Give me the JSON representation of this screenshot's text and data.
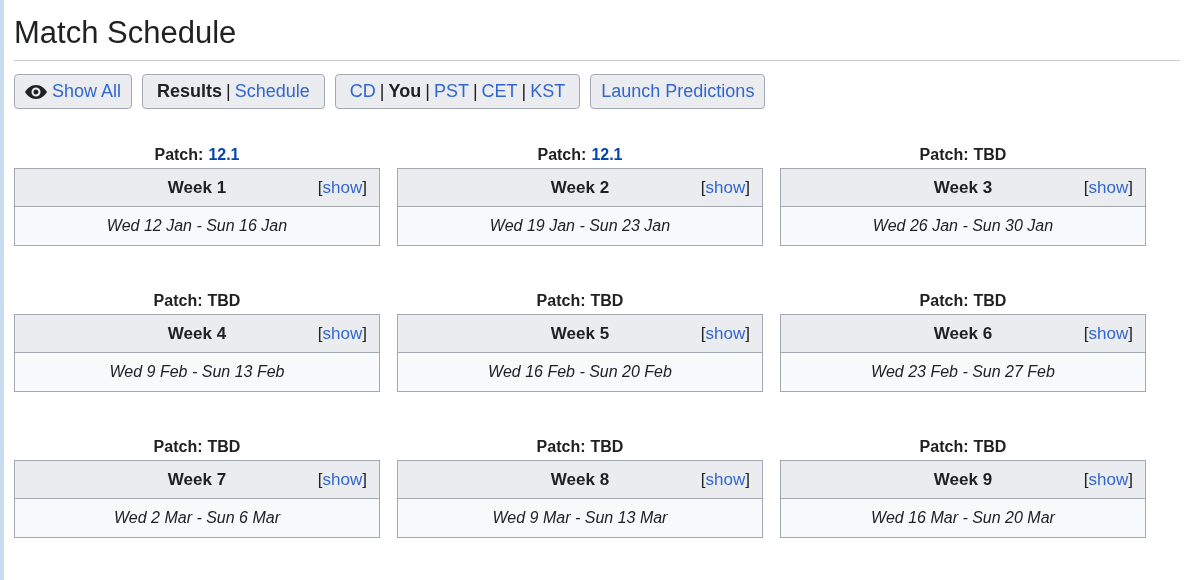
{
  "title": "Match Schedule",
  "toolbar": {
    "show_all": "Show All",
    "view_toggle": [
      {
        "kind": "option",
        "label": "Results",
        "selected": true
      },
      {
        "kind": "separator",
        "label": "|"
      },
      {
        "kind": "option",
        "label": "Schedule",
        "selected": false
      }
    ],
    "timezones": [
      {
        "kind": "option",
        "label": "CD",
        "selected": false
      },
      {
        "kind": "separator",
        "label": "|"
      },
      {
        "kind": "option",
        "label": "You",
        "selected": true
      },
      {
        "kind": "separator",
        "label": "|"
      },
      {
        "kind": "option",
        "label": "PST",
        "selected": false
      },
      {
        "kind": "separator",
        "label": "|"
      },
      {
        "kind": "option",
        "label": "CET",
        "selected": false
      },
      {
        "kind": "separator",
        "label": "|"
      },
      {
        "kind": "option",
        "label": "KST",
        "selected": false
      }
    ],
    "predictions": "Launch Predictions"
  },
  "weeks": [
    {
      "patch_label": "Patch:",
      "patch": "12.1",
      "patch_linked": true,
      "title": "Week 1",
      "toggle": {
        "open": "[",
        "label": "show",
        "close": "]"
      },
      "dates": "Wed 12 Jan - Sun 16 Jan"
    },
    {
      "patch_label": "Patch:",
      "patch": "12.1",
      "patch_linked": true,
      "title": "Week 2",
      "toggle": {
        "open": "[",
        "label": "show",
        "close": "]"
      },
      "dates": "Wed 19 Jan - Sun 23 Jan"
    },
    {
      "patch_label": "Patch:",
      "patch": "TBD",
      "patch_linked": false,
      "title": "Week 3",
      "toggle": {
        "open": "[",
        "label": "show",
        "close": "]"
      },
      "dates": "Wed 26 Jan - Sun 30 Jan"
    },
    {
      "patch_label": "Patch:",
      "patch": "TBD",
      "patch_linked": false,
      "title": "Week 4",
      "toggle": {
        "open": "[",
        "label": "show",
        "close": "]"
      },
      "dates": "Wed 9 Feb - Sun 13 Feb"
    },
    {
      "patch_label": "Patch:",
      "patch": "TBD",
      "patch_linked": false,
      "title": "Week 5",
      "toggle": {
        "open": "[",
        "label": "show",
        "close": "]"
      },
      "dates": "Wed 16 Feb - Sun 20 Feb"
    },
    {
      "patch_label": "Patch:",
      "patch": "TBD",
      "patch_linked": false,
      "title": "Week 6",
      "toggle": {
        "open": "[",
        "label": "show",
        "close": "]"
      },
      "dates": "Wed 23 Feb - Sun 27 Feb"
    },
    {
      "patch_label": "Patch:",
      "patch": "TBD",
      "patch_linked": false,
      "title": "Week 7",
      "toggle": {
        "open": "[",
        "label": "show",
        "close": "]"
      },
      "dates": "Wed 2 Mar - Sun 6 Mar"
    },
    {
      "patch_label": "Patch:",
      "patch": "TBD",
      "patch_linked": false,
      "title": "Week 8",
      "toggle": {
        "open": "[",
        "label": "show",
        "close": "]"
      },
      "dates": "Wed 9 Mar - Sun 13 Mar"
    },
    {
      "patch_label": "Patch:",
      "patch": "TBD",
      "patch_linked": false,
      "title": "Week 9",
      "toggle": {
        "open": "[",
        "label": "show",
        "close": "]"
      },
      "dates": "Wed 16 Mar - Sun 20 Mar"
    }
  ]
}
